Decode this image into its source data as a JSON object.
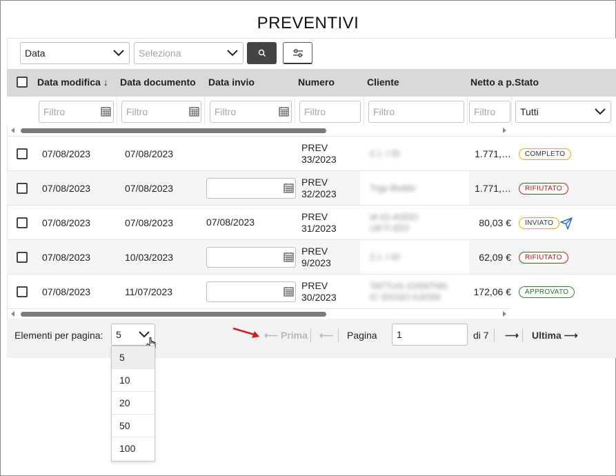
{
  "page": {
    "title": "PREVENTIVI"
  },
  "toolbar": {
    "field_select": "Data",
    "value_select_placeholder": "Seleziona"
  },
  "table": {
    "headers": [
      "Data modifica",
      "Data documento",
      "Data invio",
      "Numero",
      "Cliente",
      "Netto a p.",
      "Stato"
    ],
    "sort_indicator": "↓",
    "filter_placeholder": "Filtro",
    "status_filter": "Tutti",
    "rows": [
      {
        "modifica": "07/08/2023",
        "documento": "07/08/2023",
        "invio": "",
        "numero_1": "PREV",
        "numero_2": "33/2023",
        "cliente_1": "C.I. I ID",
        "cliente_2": "",
        "netto": "1.771,…",
        "stato": "COMPLETO",
        "stato_color": "#e0b000"
      },
      {
        "modifica": "07/08/2023",
        "documento": "07/08/2023",
        "invio": "",
        "numero_1": "PREV",
        "numero_2": "32/2023",
        "cliente_1": "Trgp Bsddo",
        "cliente_2": "",
        "netto": "1.771,…",
        "stato": "RIFIUTATO",
        "stato_color": "#d11a1a"
      },
      {
        "modifica": "07/08/2023",
        "documento": "07/08/2023",
        "invio": "07/08/2023",
        "numero_1": "PREV",
        "numero_2": "31/2023",
        "cliente_1": "tA IO-ASDO",
        "cliente_2": "UKTI-IDO",
        "netto": "80,03 €",
        "stato": "INVIATO",
        "stato_color": "#e0b000"
      },
      {
        "modifica": "07/08/2023",
        "documento": "10/03/2023",
        "invio": "",
        "numero_1": "PREV",
        "numero_2": "9/2023",
        "cliente_1": "C.I. I ID",
        "cliente_2": "",
        "netto": "62,09 €",
        "stato": "RIFIUTATO",
        "stato_color": "#d11a1a"
      },
      {
        "modifica": "07/08/2023",
        "documento": "11/07/2023",
        "invio": "",
        "numero_1": "PREV",
        "numero_2": "30/2023",
        "cliente_1": "TATTUG IOSNTNN",
        "cliente_2": "IC IDOSO IUDSN",
        "netto": "172,06 €",
        "stato": "APPROVATO",
        "stato_color": "#2a8a2a"
      }
    ]
  },
  "pagination": {
    "per_page_label": "Elementi per pagina:",
    "per_page_value": "5",
    "per_page_options": [
      "5",
      "10",
      "20",
      "50",
      "100"
    ],
    "first_label": "Prima",
    "page_label": "Pagina",
    "current_page": "1",
    "of_total": "di 7",
    "last_label": "Ultima"
  },
  "colors": {
    "header_bg": "#d9d9d9",
    "search_button_bg": "#444444",
    "annotation_arrow": "#d01c1c",
    "send_icon": "#2a6fc9"
  }
}
